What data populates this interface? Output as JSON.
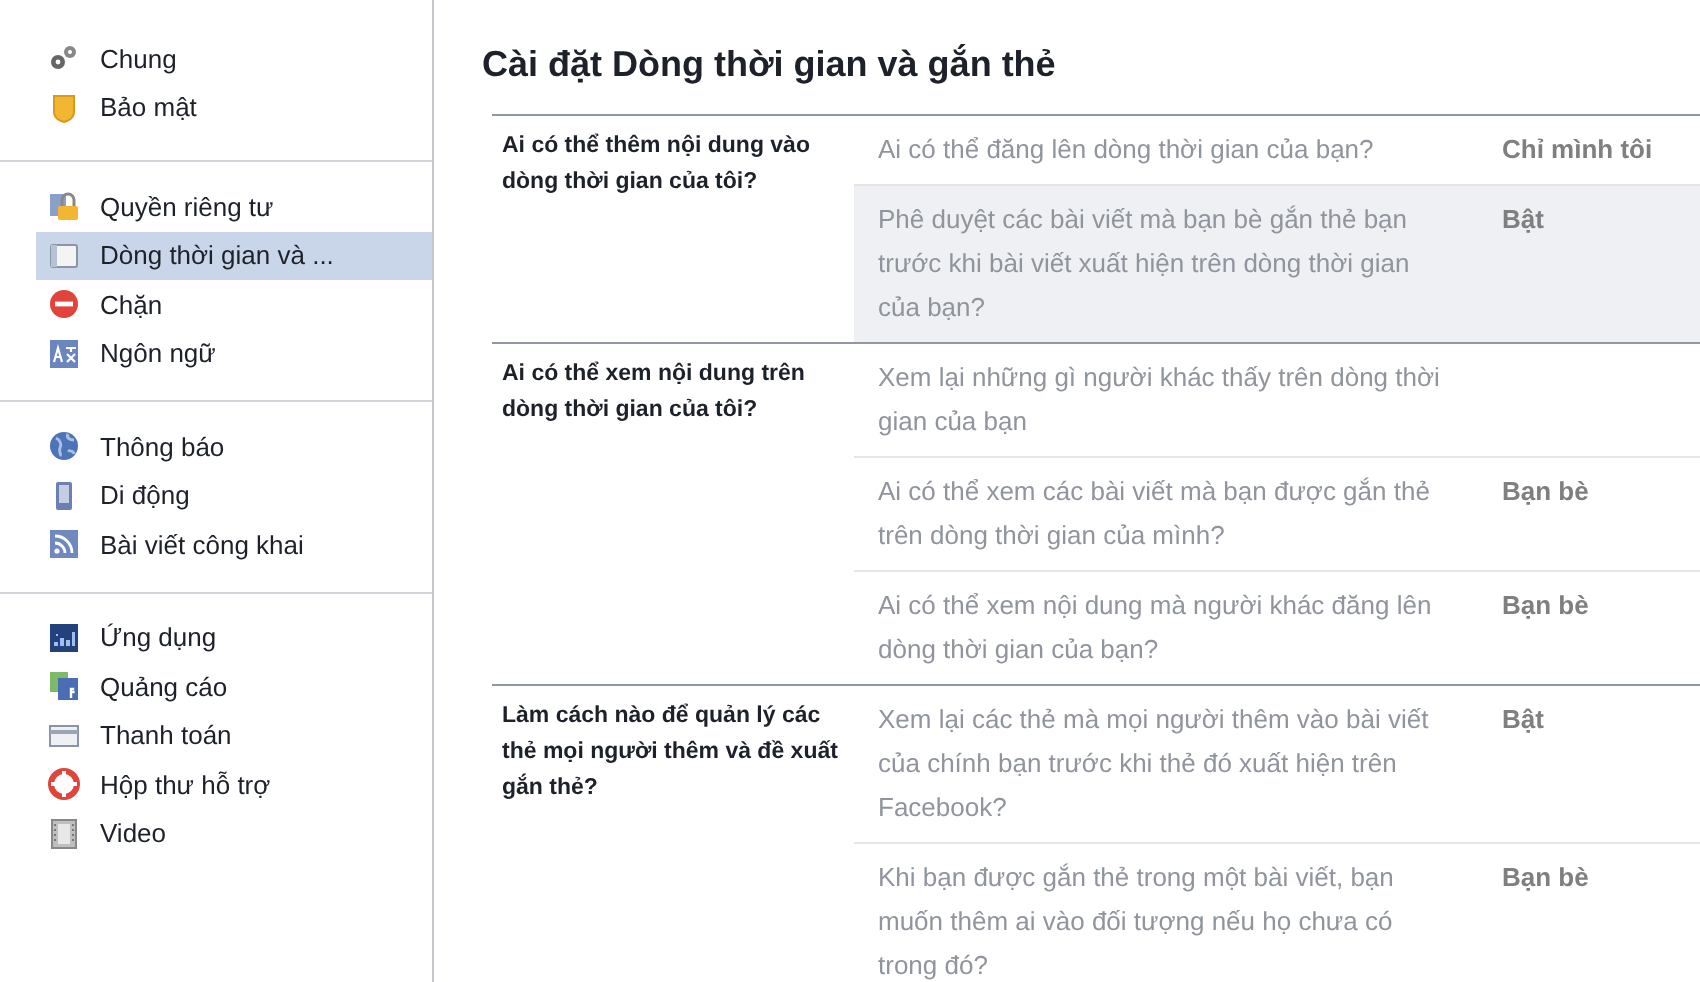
{
  "sidebar": {
    "groups": [
      {
        "items": [
          {
            "label": "Chung",
            "selected": false
          },
          {
            "label": "Bảo mật",
            "selected": false
          }
        ]
      },
      {
        "items": [
          {
            "label": "Quyền riêng tư",
            "selected": false
          },
          {
            "label": "Dòng thời gian và ...",
            "selected": true
          },
          {
            "label": "Chặn",
            "selected": false
          },
          {
            "label": "Ngôn ngữ",
            "selected": false
          }
        ]
      },
      {
        "items": [
          {
            "label": "Thông báo",
            "selected": false
          },
          {
            "label": "Di động",
            "selected": false
          },
          {
            "label": "Bài viết công khai",
            "selected": false
          }
        ]
      },
      {
        "items": [
          {
            "label": "Ứng dụng",
            "selected": false
          },
          {
            "label": "Quảng cáo",
            "selected": false
          },
          {
            "label": "Thanh toán",
            "selected": false
          },
          {
            "label": "Hộp thư hỗ trợ",
            "selected": false
          },
          {
            "label": "Video",
            "selected": false
          }
        ]
      }
    ]
  },
  "main": {
    "title": "Cài đặt Dòng thời gian và gắn thẻ",
    "sections": [
      {
        "heading": "Ai có thể thêm nội dung vào dòng thời gian của tôi?",
        "rows": [
          {
            "question": "Ai có thể đăng lên dòng thời gian của bạn?",
            "value": "Chỉ mình tôi",
            "highlighted": false
          },
          {
            "question": "Phê duyệt các bài viết mà bạn bè gắn thẻ bạn trước khi bài viết xuất hiện trên dòng thời gian của bạn?",
            "value": "Bật",
            "highlighted": true
          }
        ]
      },
      {
        "heading": "Ai có thể xem nội dung trên dòng thời gian của tôi?",
        "rows": [
          {
            "question": "Xem lại những gì người khác thấy trên dòng thời gian của bạn",
            "highlighted": false
          },
          {
            "question": "Ai có thể xem các bài viết mà bạn được gắn thẻ trên dòng thời gian của mình?",
            "value": "Bạn bè",
            "highlighted": false
          },
          {
            "question": "Ai có thể xem nội dung mà người khác đăng lên dòng thời gian của bạn?",
            "value": "Bạn bè",
            "highlighted": false
          }
        ]
      },
      {
        "heading": "Làm cách nào để quản lý các thẻ mọi người thêm và đề xuất gắn thẻ?",
        "rows": [
          {
            "question": "Xem lại các thẻ mà mọi người thêm vào bài viết của chính bạn trước khi thẻ đó xuất hiện trên Facebook?",
            "value": "Bật",
            "highlighted": false
          },
          {
            "question": "Khi bạn được gắn thẻ trong một bài viết, bạn muốn thêm ai vào đối tượng nếu họ chưa có trong đó?",
            "value": "Bạn bè",
            "highlighted": false
          }
        ]
      }
    ]
  }
}
